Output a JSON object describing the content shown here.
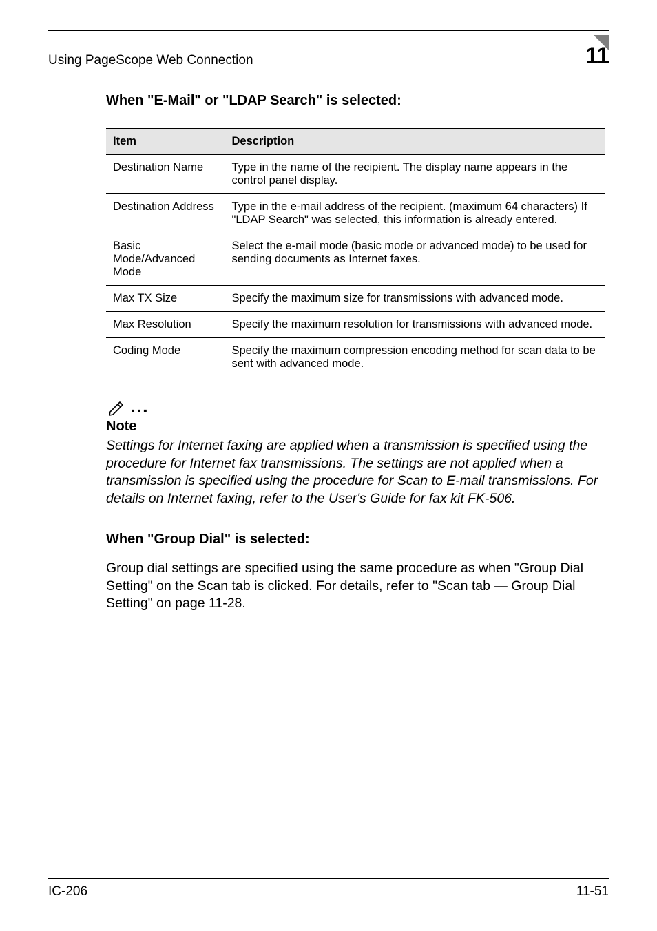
{
  "header": {
    "running_head": "Using PageScope Web Connection",
    "chapter_number": "11"
  },
  "section1": {
    "heading": "When \"E-Mail\" or \"LDAP Search\" is selected:",
    "table": {
      "head": {
        "c1": "Item",
        "c2": "Description"
      },
      "rows": [
        {
          "c1": "Destination Name",
          "c2": "Type in the name of the recipient. The display name appears in the control panel display."
        },
        {
          "c1": "Destination Address",
          "c2": "Type in the e-mail address of the recipient. (maximum 64 characters) If \"LDAP Search\" was selected, this information is already entered."
        },
        {
          "c1": "Basic Mode/Advanced Mode",
          "c2": "Select the e-mail mode (basic mode or advanced mode) to be used for sending documents as Internet faxes."
        },
        {
          "c1": "Max TX Size",
          "c2": "Specify the maximum size for transmissions with advanced mode."
        },
        {
          "c1": "Max Resolution",
          "c2": "Specify the maximum resolution for transmissions with advanced mode."
        },
        {
          "c1": "Coding Mode",
          "c2": "Specify the maximum compression encoding method for scan data to be sent with advanced mode."
        }
      ]
    }
  },
  "note": {
    "label": "Note",
    "body": "Settings for Internet faxing are applied when a transmission is specified using the procedure for Internet fax transmissions. The settings are not applied when a transmission is specified using the procedure for Scan to E-mail transmissions. For details on Internet faxing, refer to the User's Guide for fax kit FK-506."
  },
  "section2": {
    "heading": "When \"Group Dial\" is selected:",
    "body": "Group dial settings are specified using the same procedure as when \"Group Dial Setting\" on the Scan tab is clicked. For details, refer to \"Scan tab — Group Dial Setting\" on page 11-28."
  },
  "footer": {
    "left": "IC-206",
    "right": "11-51"
  }
}
